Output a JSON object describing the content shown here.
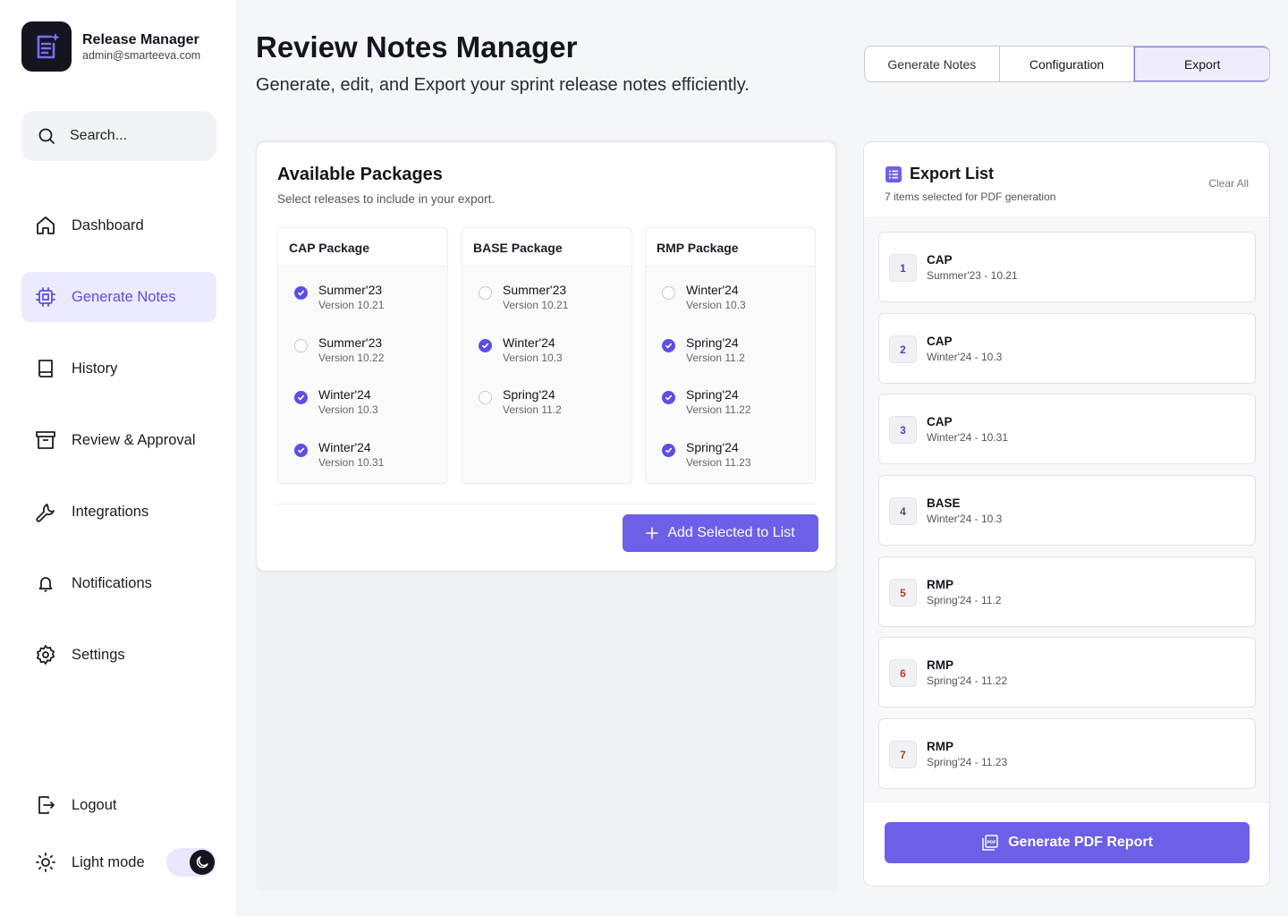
{
  "brand": {
    "name": "Release Manager",
    "email": "admin@smarteeva.com"
  },
  "search": {
    "placeholder": "Search..."
  },
  "nav": {
    "dashboard": "Dashboard",
    "generate": "Generate Notes",
    "history": "History",
    "review": "Review & Approval",
    "integrations": "Integrations",
    "notifications": "Notifications",
    "settings": "Settings",
    "logout": "Logout",
    "mode": "Light mode"
  },
  "header": {
    "title": "Review Notes Manager",
    "subtitle": "Generate, edit, and Export your sprint release notes efficiently.",
    "tabs": [
      "Generate Notes",
      "Configuration",
      "Export"
    ],
    "active_tab": "Export"
  },
  "packages": {
    "title": "Available Packages",
    "description": "Select releases to include in your export.",
    "groups": [
      {
        "name": "CAP Package",
        "releases": [
          {
            "name": "Summer'23",
            "version": "Version 10.21",
            "checked": true
          },
          {
            "name": "Summer'23",
            "version": "Version 10.22",
            "checked": false
          },
          {
            "name": "Winter'24",
            "version": "Version 10.3",
            "checked": true
          },
          {
            "name": "Winter'24",
            "version": "Version 10.31",
            "checked": true
          }
        ]
      },
      {
        "name": "BASE Package",
        "releases": [
          {
            "name": "Summer'23",
            "version": "Version 10.21",
            "checked": false
          },
          {
            "name": "Winter'24",
            "version": "Version 10.3",
            "checked": true
          },
          {
            "name": "Spring'24",
            "version": "Version 11.2",
            "checked": false
          }
        ]
      },
      {
        "name": "RMP Package",
        "releases": [
          {
            "name": "Winter'24",
            "version": "Version 10.3",
            "checked": false
          },
          {
            "name": "Spring'24",
            "version": "Version 11.2",
            "checked": true
          },
          {
            "name": "Spring'24",
            "version": "Version 11.22",
            "checked": true
          },
          {
            "name": "Spring'24",
            "version": "Version 11.23",
            "checked": true
          }
        ]
      }
    ],
    "add_button": "Add Selected to List"
  },
  "export": {
    "title": "Export List",
    "subtitle": "7 items selected for PDF generation",
    "clear": "Clear All",
    "items": [
      {
        "num": "1",
        "name": "CAP",
        "detail": "Summer'23 - 10.21",
        "num_color": "#4b44c8"
      },
      {
        "num": "2",
        "name": "CAP",
        "detail": "Winter'24 - 10.3",
        "num_color": "#4b44c8"
      },
      {
        "num": "3",
        "name": "CAP",
        "detail": "Winter'24 - 10.31",
        "num_color": "#4b44c8"
      },
      {
        "num": "4",
        "name": "BASE",
        "detail": "Winter'24 - 10.3",
        "num_color": "#555555"
      },
      {
        "num": "5",
        "name": "RMP",
        "detail": "Spring'24 - 11.2",
        "num_color": "#c0392b"
      },
      {
        "num": "6",
        "name": "RMP",
        "detail": "Spring'24 - 11.22",
        "num_color": "#c0392b"
      },
      {
        "num": "7",
        "name": "RMP",
        "detail": "Spring'24 - 11.23",
        "num_color": "#c0392b"
      }
    ],
    "generate_button": "Generate PDF Report"
  },
  "colors": {
    "accent": "#6c5fe8",
    "accent_light": "#eceafd",
    "dark": "#15151f"
  }
}
